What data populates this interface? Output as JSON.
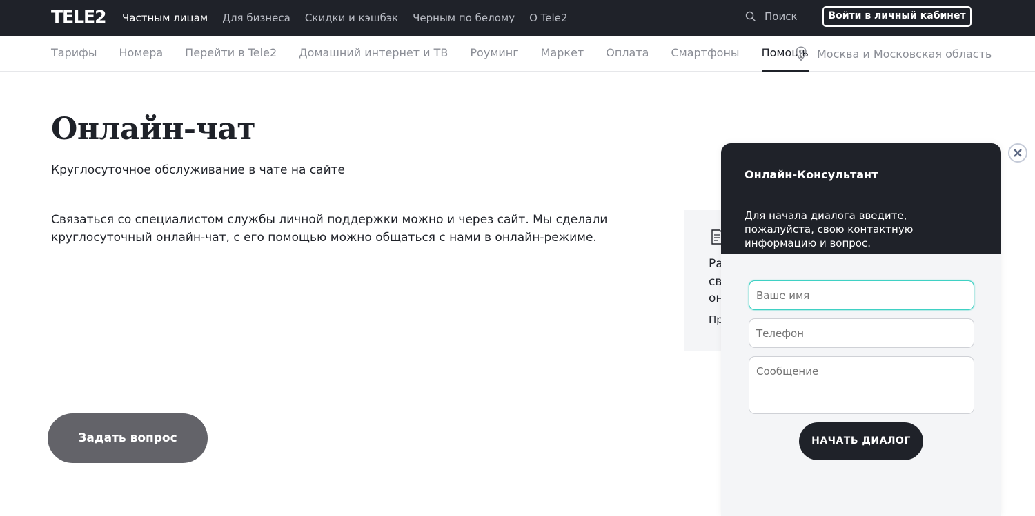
{
  "header": {
    "logo": "TELE2",
    "nav": [
      {
        "label": "Частным лицам",
        "active": true
      },
      {
        "label": "Для бизнеса"
      },
      {
        "label": "Скидки и кэшбэк"
      },
      {
        "label": "Черным по белому"
      },
      {
        "label": "О Tele2"
      }
    ],
    "search_label": "Поиск",
    "login_label": "Войти в личный кабинет"
  },
  "subnav": {
    "items": [
      {
        "label": "Тарифы"
      },
      {
        "label": "Номера"
      },
      {
        "label": "Перейти в Tele2"
      },
      {
        "label": "Домашний интернет и ТВ"
      },
      {
        "label": "Роуминг"
      },
      {
        "label": "Маркет"
      },
      {
        "label": "Оплата"
      },
      {
        "label": "Смартфоны"
      },
      {
        "label": "Помощь",
        "active": true
      }
    ],
    "region": "Москва и Московская область"
  },
  "main": {
    "title": "Онлайн-чат",
    "subtitle": "Круглосуточное обслуживание в чате на сайте",
    "description": "Связаться со специалистом службы личной поддержки можно и через сайт. Мы сделали круглосуточный онлайн-чат, с его помощью можно общаться с нами в онлайн-режиме.",
    "ask_button": "Задать вопрос",
    "side_card": {
      "lines": [
        "Ра",
        "св",
        "он"
      ],
      "link": "Пр"
    }
  },
  "chat": {
    "title": "Онлайн-Консультант",
    "intro": "Для начала диалога введите, пожалуйста, свою контактную информацию и вопрос.",
    "name_placeholder": "Ваше имя",
    "phone_placeholder": "Телефон",
    "message_placeholder": "Сообщение",
    "start_button": "НАЧАТЬ ДИАЛОГ"
  },
  "colors": {
    "dark": "#1f2229",
    "muted": "#8b8e96",
    "focus": "#3fd1c4",
    "ask_button": "#636369"
  },
  "icons": [
    "search-icon",
    "location-pin-icon",
    "document-icon",
    "close-icon"
  ]
}
